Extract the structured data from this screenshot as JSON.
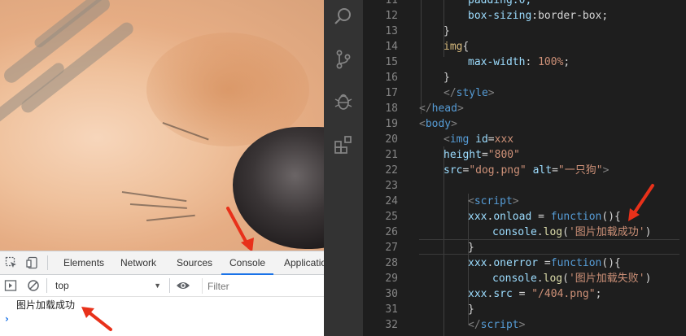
{
  "devtools": {
    "tabs": [
      {
        "label": "Elements"
      },
      {
        "label": "Network"
      },
      {
        "label": "Sources"
      },
      {
        "label": "Console"
      },
      {
        "label": "Applicatio"
      }
    ],
    "active_tab": "Console",
    "context": "top",
    "filter_placeholder": "Filter",
    "log_message": "图片加载成功",
    "prompt_symbol": "›"
  },
  "viewport": {
    "image_alt": "一只狗"
  },
  "activity_bar": {
    "icons": [
      "search-icon",
      "source-control-icon",
      "debug-icon",
      "extensions-icon"
    ]
  },
  "editor": {
    "lines": [
      {
        "num": "11",
        "indent": 2,
        "tokens": [
          {
            "t": "padding:0;",
            "c": "prop"
          }
        ]
      },
      {
        "num": "12",
        "indent": 2,
        "tokens": [
          {
            "t": "box-sizing",
            "c": "prop"
          },
          {
            "t": ":",
            "c": "plain"
          },
          {
            "t": "border-box",
            "c": "plain"
          },
          {
            "t": ";",
            "c": "plain"
          }
        ]
      },
      {
        "num": "13",
        "indent": 1,
        "tokens": [
          {
            "t": "}",
            "c": "plain"
          }
        ]
      },
      {
        "num": "14",
        "indent": 1,
        "tokens": [
          {
            "t": "img",
            "c": "sel"
          },
          {
            "t": "{",
            "c": "plain"
          }
        ]
      },
      {
        "num": "15",
        "indent": 2,
        "tokens": [
          {
            "t": "max-width",
            "c": "prop"
          },
          {
            "t": ": ",
            "c": "plain"
          },
          {
            "t": "100%",
            "c": "val"
          },
          {
            "t": ";",
            "c": "plain"
          }
        ]
      },
      {
        "num": "16",
        "indent": 1,
        "tokens": [
          {
            "t": "}",
            "c": "plain"
          }
        ]
      },
      {
        "num": "17",
        "indent": 1,
        "tokens": [
          {
            "t": "</",
            "c": "punc"
          },
          {
            "t": "style",
            "c": "tag"
          },
          {
            "t": ">",
            "c": "punc"
          }
        ]
      },
      {
        "num": "18",
        "indent": 0,
        "tokens": [
          {
            "t": "</",
            "c": "punc"
          },
          {
            "t": "head",
            "c": "tag"
          },
          {
            "t": ">",
            "c": "punc"
          }
        ]
      },
      {
        "num": "19",
        "indent": 0,
        "tokens": [
          {
            "t": "<",
            "c": "punc"
          },
          {
            "t": "body",
            "c": "tag"
          },
          {
            "t": ">",
            "c": "punc"
          }
        ]
      },
      {
        "num": "20",
        "indent": 1,
        "tokens": [
          {
            "t": "<",
            "c": "punc"
          },
          {
            "t": "img",
            "c": "tag"
          },
          {
            "t": " ",
            "c": "plain"
          },
          {
            "t": "id",
            "c": "attr"
          },
          {
            "t": "=",
            "c": "plain"
          },
          {
            "t": "xxx",
            "c": "str"
          }
        ]
      },
      {
        "num": "21",
        "indent": 1,
        "tokens": [
          {
            "t": "height",
            "c": "attr"
          },
          {
            "t": "=",
            "c": "plain"
          },
          {
            "t": "\"800\"",
            "c": "str"
          }
        ]
      },
      {
        "num": "22",
        "indent": 1,
        "tokens": [
          {
            "t": "src",
            "c": "attr"
          },
          {
            "t": "=",
            "c": "plain"
          },
          {
            "t": "\"dog.png\"",
            "c": "str"
          },
          {
            "t": " ",
            "c": "plain"
          },
          {
            "t": "alt",
            "c": "attr"
          },
          {
            "t": "=",
            "c": "plain"
          },
          {
            "t": "\"一只狗\"",
            "c": "str"
          },
          {
            "t": ">",
            "c": "punc"
          }
        ]
      },
      {
        "num": "23",
        "indent": 0,
        "tokens": []
      },
      {
        "num": "24",
        "indent": 2,
        "tokens": [
          {
            "t": "<",
            "c": "punc"
          },
          {
            "t": "script",
            "c": "tag"
          },
          {
            "t": ">",
            "c": "punc"
          }
        ]
      },
      {
        "num": "25",
        "indent": 2,
        "tokens": [
          {
            "t": "xxx",
            "c": "attr"
          },
          {
            "t": ".",
            "c": "plain"
          },
          {
            "t": "onload",
            "c": "attr"
          },
          {
            "t": " = ",
            "c": "plain"
          },
          {
            "t": "function",
            "c": "kw"
          },
          {
            "t": "()",
            "c": "plain"
          },
          {
            "t": "{",
            "c": "plain"
          }
        ]
      },
      {
        "num": "26",
        "indent": 3,
        "tokens": [
          {
            "t": "console",
            "c": "attr"
          },
          {
            "t": ".",
            "c": "plain"
          },
          {
            "t": "log",
            "c": "fn"
          },
          {
            "t": "(",
            "c": "plain"
          },
          {
            "t": "'图片加载成功'",
            "c": "str"
          },
          {
            "t": ")",
            "c": "plain"
          }
        ]
      },
      {
        "num": "27",
        "indent": 2,
        "tokens": [
          {
            "t": "}",
            "c": "plain"
          }
        ]
      },
      {
        "num": "28",
        "indent": 2,
        "tokens": [
          {
            "t": "xxx",
            "c": "attr"
          },
          {
            "t": ".",
            "c": "plain"
          },
          {
            "t": "onerror",
            "c": "attr"
          },
          {
            "t": " =",
            "c": "plain"
          },
          {
            "t": "function",
            "c": "kw"
          },
          {
            "t": "(){",
            "c": "plain"
          }
        ]
      },
      {
        "num": "29",
        "indent": 3,
        "tokens": [
          {
            "t": "console",
            "c": "attr"
          },
          {
            "t": ".",
            "c": "plain"
          },
          {
            "t": "log",
            "c": "fn"
          },
          {
            "t": "(",
            "c": "plain"
          },
          {
            "t": "'图片加载失败'",
            "c": "str"
          },
          {
            "t": ")",
            "c": "plain"
          }
        ]
      },
      {
        "num": "30",
        "indent": 2,
        "tokens": [
          {
            "t": "xxx",
            "c": "attr"
          },
          {
            "t": ".",
            "c": "plain"
          },
          {
            "t": "src",
            "c": "attr"
          },
          {
            "t": " = ",
            "c": "plain"
          },
          {
            "t": "\"/404.png\"",
            "c": "str"
          },
          {
            "t": ";",
            "c": "plain"
          }
        ]
      },
      {
        "num": "31",
        "indent": 2,
        "tokens": [
          {
            "t": "}",
            "c": "plain"
          }
        ]
      },
      {
        "num": "32",
        "indent": 2,
        "tokens": [
          {
            "t": "</",
            "c": "punc"
          },
          {
            "t": "script",
            "c": "tag"
          },
          {
            "t": ">",
            "c": "punc"
          }
        ]
      }
    ]
  },
  "colors": {
    "editor_bg": "#1e1e1e",
    "activity_bg": "#333333",
    "annotation_arrow": "#e8311a",
    "devtools_active_tab": "#1a73e8"
  }
}
